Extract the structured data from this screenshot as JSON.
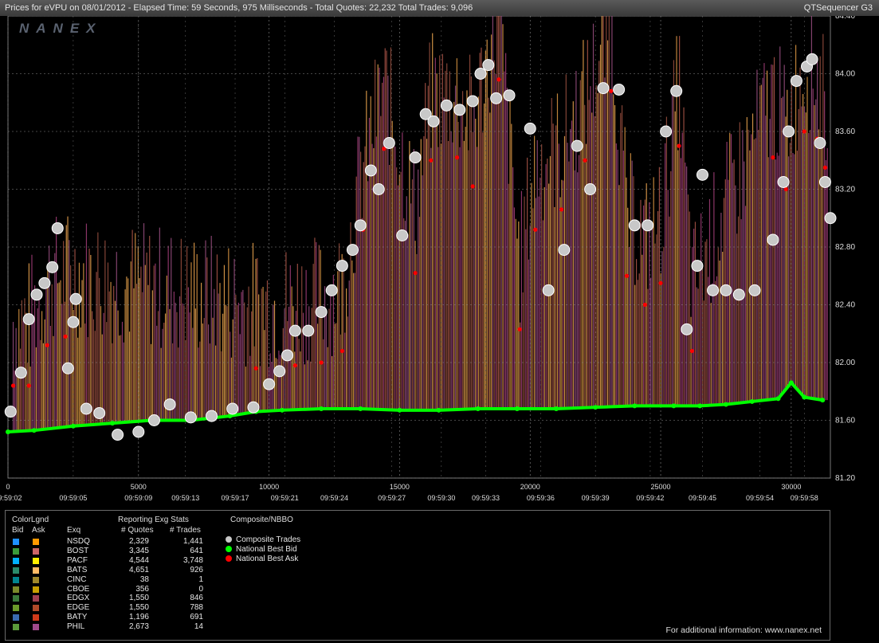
{
  "header": {
    "title": "Prices for  eVPU  on  08/01/2012  -  Elapsed Time: 59 Seconds, 975 Milliseconds  -  Total Quotes: 22,232  Total Trades: 9,096",
    "app_name": "QTSequencer G3"
  },
  "watermark": "NANEX",
  "chart_data": {
    "type": "scatter",
    "x_ticks": [
      0,
      5000,
      10000,
      15000,
      20000,
      25000,
      30000
    ],
    "x_range": [
      0,
      31500
    ],
    "y_range": [
      81.2,
      84.4
    ],
    "y_ticks": [
      "84.40",
      "84.00",
      "83.60",
      "83.20",
      "82.80",
      "82.40",
      "82.00",
      "81.60",
      "81.20"
    ],
    "time_labels": [
      {
        "x": 0,
        "label": "09:59:02"
      },
      {
        "x": 2500,
        "label": "09:59:05"
      },
      {
        "x": 5000,
        "label": "09:59:09"
      },
      {
        "x": 6800,
        "label": "09:59:13"
      },
      {
        "x": 8700,
        "label": "09:59:17"
      },
      {
        "x": 10600,
        "label": "09:59:21"
      },
      {
        "x": 12500,
        "label": "09:59:24"
      },
      {
        "x": 14700,
        "label": "09:59:27"
      },
      {
        "x": 16600,
        "label": "09:59:30"
      },
      {
        "x": 18300,
        "label": "09:59:33"
      },
      {
        "x": 20400,
        "label": "09:59:36"
      },
      {
        "x": 22500,
        "label": "09:59:39"
      },
      {
        "x": 24600,
        "label": "09:59:42"
      },
      {
        "x": 26600,
        "label": "09:59:45"
      },
      {
        "x": 28800,
        "label": "09:59:54"
      },
      {
        "x": 30500,
        "label": "09:59:58"
      }
    ],
    "grid": true,
    "series": [
      {
        "name": "Composite Trades",
        "color": "#c8c8c8",
        "points": [
          [
            100,
            81.66
          ],
          [
            500,
            81.93
          ],
          [
            800,
            82.3
          ],
          [
            1100,
            82.47
          ],
          [
            1400,
            82.55
          ],
          [
            1700,
            82.66
          ],
          [
            1900,
            82.93
          ],
          [
            2300,
            81.96
          ],
          [
            2500,
            82.28
          ],
          [
            2600,
            82.44
          ],
          [
            3000,
            81.68
          ],
          [
            3500,
            81.65
          ],
          [
            4200,
            81.5
          ],
          [
            5000,
            81.52
          ],
          [
            5600,
            81.6
          ],
          [
            6200,
            81.71
          ],
          [
            7000,
            81.62
          ],
          [
            7800,
            81.63
          ],
          [
            8600,
            81.68
          ],
          [
            9400,
            81.69
          ],
          [
            10000,
            81.85
          ],
          [
            10400,
            81.94
          ],
          [
            10700,
            82.05
          ],
          [
            11000,
            82.22
          ],
          [
            11500,
            82.22
          ],
          [
            12000,
            82.35
          ],
          [
            12400,
            82.5
          ],
          [
            12800,
            82.67
          ],
          [
            13200,
            82.78
          ],
          [
            13500,
            82.95
          ],
          [
            13900,
            83.33
          ],
          [
            14200,
            83.2
          ],
          [
            14600,
            83.52
          ],
          [
            15100,
            82.88
          ],
          [
            15600,
            83.42
          ],
          [
            16000,
            83.72
          ],
          [
            16300,
            83.67
          ],
          [
            16800,
            83.78
          ],
          [
            17300,
            83.75
          ],
          [
            17800,
            83.81
          ],
          [
            18100,
            84.0
          ],
          [
            18400,
            84.06
          ],
          [
            18700,
            83.83
          ],
          [
            19200,
            83.85
          ],
          [
            20000,
            83.62
          ],
          [
            20700,
            82.5
          ],
          [
            21300,
            82.78
          ],
          [
            21800,
            83.5
          ],
          [
            22300,
            83.2
          ],
          [
            22800,
            83.9
          ],
          [
            23400,
            83.89
          ],
          [
            24000,
            82.95
          ],
          [
            24500,
            82.95
          ],
          [
            25200,
            83.6
          ],
          [
            25600,
            83.88
          ],
          [
            26000,
            82.23
          ],
          [
            26400,
            82.67
          ],
          [
            26600,
            83.3
          ],
          [
            27000,
            82.5
          ],
          [
            27500,
            82.5
          ],
          [
            28000,
            82.47
          ],
          [
            28600,
            82.5
          ],
          [
            29300,
            82.85
          ],
          [
            29700,
            83.25
          ],
          [
            29900,
            83.6
          ],
          [
            30200,
            83.95
          ],
          [
            30600,
            84.05
          ],
          [
            30800,
            84.1
          ],
          [
            31100,
            83.52
          ],
          [
            31300,
            83.25
          ],
          [
            31500,
            83.0
          ]
        ]
      },
      {
        "name": "National Best Bid",
        "color": "#00ff00",
        "points": [
          [
            0,
            81.52
          ],
          [
            1000,
            81.53
          ],
          [
            2500,
            81.56
          ],
          [
            4000,
            81.58
          ],
          [
            5500,
            81.6
          ],
          [
            7000,
            81.6
          ],
          [
            8500,
            81.63
          ],
          [
            9500,
            81.66
          ],
          [
            10500,
            81.67
          ],
          [
            12000,
            81.68
          ],
          [
            13500,
            81.68
          ],
          [
            15000,
            81.67
          ],
          [
            16500,
            81.67
          ],
          [
            18000,
            81.68
          ],
          [
            19500,
            81.68
          ],
          [
            21000,
            81.68
          ],
          [
            22500,
            81.69
          ],
          [
            24000,
            81.7
          ],
          [
            25500,
            81.7
          ],
          [
            26500,
            81.7
          ],
          [
            27500,
            81.71
          ],
          [
            28500,
            81.73
          ],
          [
            29500,
            81.75
          ],
          [
            30000,
            81.86
          ],
          [
            30500,
            81.76
          ],
          [
            31200,
            81.74
          ]
        ]
      },
      {
        "name": "National Best Ask",
        "color": "#ff0000",
        "points": [
          [
            200,
            81.84
          ],
          [
            800,
            81.84
          ],
          [
            1500,
            82.12
          ],
          [
            2200,
            82.18
          ],
          [
            9500,
            81.96
          ],
          [
            10400,
            81.95
          ],
          [
            11000,
            81.98
          ],
          [
            12000,
            82.0
          ],
          [
            12800,
            82.08
          ],
          [
            13600,
            82.92
          ],
          [
            14400,
            83.48
          ],
          [
            15600,
            82.62
          ],
          [
            16200,
            83.4
          ],
          [
            17200,
            83.42
          ],
          [
            17800,
            83.22
          ],
          [
            18800,
            83.96
          ],
          [
            19600,
            82.23
          ],
          [
            20200,
            82.92
          ],
          [
            21200,
            83.06
          ],
          [
            22100,
            83.4
          ],
          [
            23100,
            83.88
          ],
          [
            23700,
            82.6
          ],
          [
            24400,
            82.4
          ],
          [
            25000,
            82.55
          ],
          [
            25700,
            83.5
          ],
          [
            26200,
            82.08
          ],
          [
            29300,
            83.42
          ],
          [
            29800,
            83.2
          ],
          [
            30500,
            83.6
          ],
          [
            31000,
            83.55
          ],
          [
            31300,
            83.35
          ]
        ]
      }
    ]
  },
  "legend": {
    "color_legend_title": "ColorLgnd",
    "bid_header": "Bid",
    "ask_header": "Ask",
    "exch_header": "Exq",
    "stats_title": "Reporting Exg Stats",
    "quotes_header": "# Quotes",
    "trades_header": "# Trades",
    "composite_title": "Composite/NBBO",
    "rows": [
      {
        "exch": "NSDQ",
        "quotes": "2,329",
        "trades": "1,441",
        "bid_color": "#1e90ff",
        "ask_color": "#ff9900"
      },
      {
        "exch": "BOST",
        "quotes": "3,345",
        "trades": "641",
        "bid_color": "#3a9a3a",
        "ask_color": "#cc6666"
      },
      {
        "exch": "PACF",
        "quotes": "4,544",
        "trades": "3,748",
        "bid_color": "#00b0ff",
        "ask_color": "#ffee00"
      },
      {
        "exch": "BATS",
        "quotes": "4,651",
        "trades": "926",
        "bid_color": "#2a8a6a",
        "ask_color": "#ffbb66"
      },
      {
        "exch": "CINC",
        "quotes": "38",
        "trades": "1",
        "bid_color": "#00838f",
        "ask_color": "#a0882a"
      },
      {
        "exch": "CBOE",
        "quotes": "356",
        "trades": "0",
        "bid_color": "#7a8a2a",
        "ask_color": "#c8a000"
      },
      {
        "exch": "EDGX",
        "quotes": "1,550",
        "trades": "846",
        "bid_color": "#3a7a3a",
        "ask_color": "#a04050"
      },
      {
        "exch": "EDGE",
        "quotes": "1,550",
        "trades": "788",
        "bid_color": "#6a9a2a",
        "ask_color": "#b04a2a"
      },
      {
        "exch": "BATY",
        "quotes": "1,196",
        "trades": "691",
        "bid_color": "#3a6ab0",
        "ask_color": "#d03a1a"
      },
      {
        "exch": "PHIL",
        "quotes": "2,673",
        "trades": "14",
        "bid_color": "#5a9a3a",
        "ask_color": "#a04a8a"
      }
    ],
    "composite_items": [
      {
        "label": "Composite Trades",
        "color": "#c8c8c8"
      },
      {
        "label": "National Best Bid",
        "color": "#00ff00"
      },
      {
        "label": "National Best Ask",
        "color": "#ff0000"
      }
    ]
  },
  "footer": "For additional information: www.nanex.net"
}
